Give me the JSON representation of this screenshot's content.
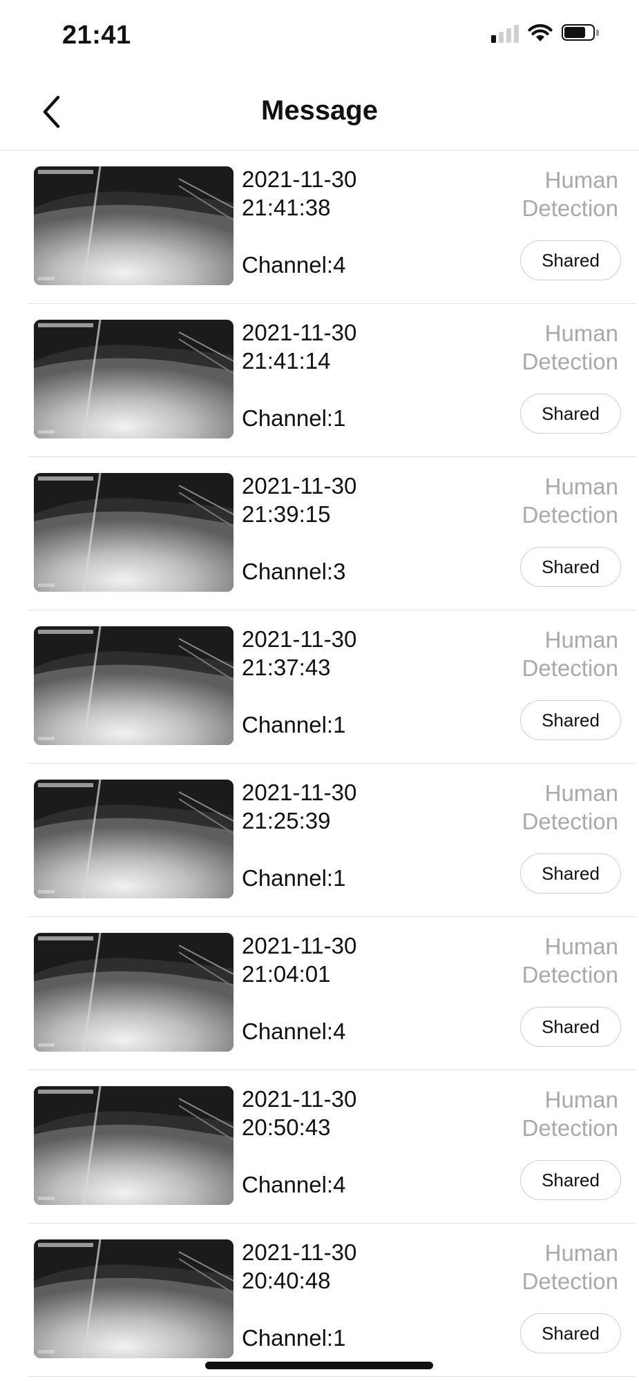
{
  "status_bar": {
    "time": "21:41"
  },
  "header": {
    "title": "Message",
    "back_icon": "chevron-left-icon"
  },
  "messages": [
    {
      "date": "2021-11-30",
      "time": "21:41:38",
      "channel": "Channel:4",
      "type_line1": "Human",
      "type_line2": "Detection",
      "action_label": "Shared"
    },
    {
      "date": "2021-11-30",
      "time": "21:41:14",
      "channel": "Channel:1",
      "type_line1": "Human",
      "type_line2": "Detection",
      "action_label": "Shared"
    },
    {
      "date": "2021-11-30",
      "time": "21:39:15",
      "channel": "Channel:3",
      "type_line1": "Human",
      "type_line2": "Detection",
      "action_label": "Shared"
    },
    {
      "date": "2021-11-30",
      "time": "21:37:43",
      "channel": "Channel:1",
      "type_line1": "Human",
      "type_line2": "Detection",
      "action_label": "Shared"
    },
    {
      "date": "2021-11-30",
      "time": "21:25:39",
      "channel": "Channel:1",
      "type_line1": "Human",
      "type_line2": "Detection",
      "action_label": "Shared"
    },
    {
      "date": "2021-11-30",
      "time": "21:04:01",
      "channel": "Channel:4",
      "type_line1": "Human",
      "type_line2": "Detection",
      "action_label": "Shared"
    },
    {
      "date": "2021-11-30",
      "time": "20:50:43",
      "channel": "Channel:4",
      "type_line1": "Human",
      "type_line2": "Detection",
      "action_label": "Shared"
    },
    {
      "date": "2021-11-30",
      "time": "20:40:48",
      "channel": "Channel:1",
      "type_line1": "Human",
      "type_line2": "Detection",
      "action_label": "Shared"
    }
  ],
  "colors": {
    "text": "#111111",
    "muted_text": "#a9a9a9",
    "divider": "#e2e2e2",
    "button_border": "#cfcfcf"
  }
}
